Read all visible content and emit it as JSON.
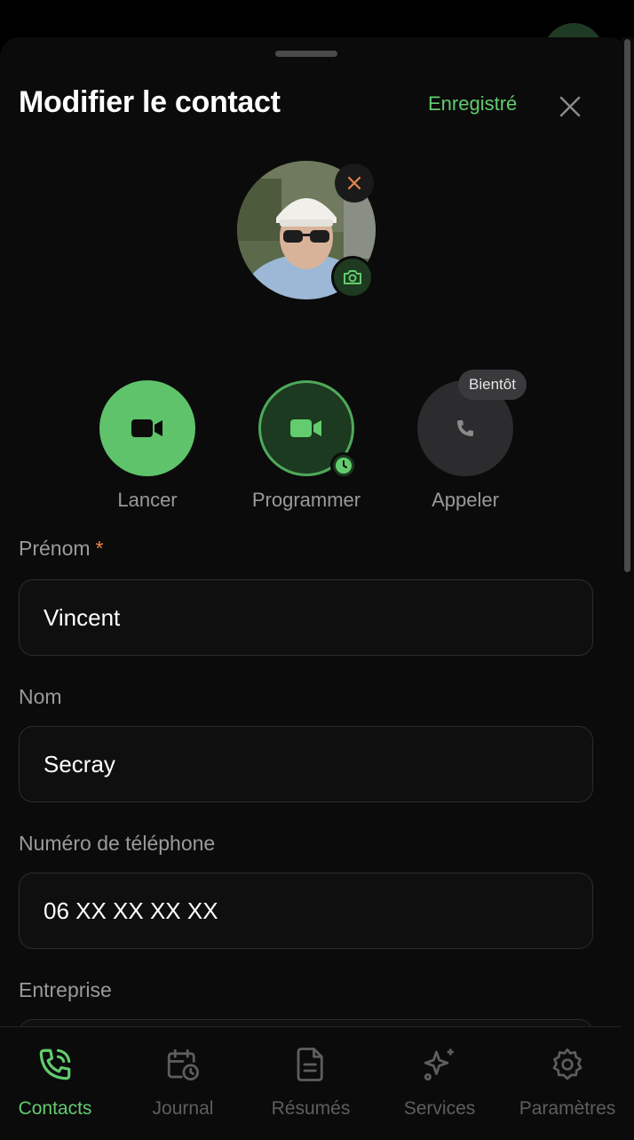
{
  "header": {
    "title": "Modifier le contact",
    "status": "Enregistré"
  },
  "actions": [
    {
      "label": "Lancer",
      "icon": "video-icon"
    },
    {
      "label": "Programmer",
      "icon": "video-icon"
    },
    {
      "label": "Appeler",
      "icon": "phone-icon",
      "badge": "Bientôt"
    }
  ],
  "form": {
    "first_name": {
      "label": "Prénom",
      "required_mark": "*",
      "value": "Vincent"
    },
    "last_name": {
      "label": "Nom",
      "value": "Secray"
    },
    "phone": {
      "label": "Numéro de téléphone",
      "value": "06 XX XX XX XX"
    },
    "company": {
      "label": "Entreprise",
      "value": ""
    }
  },
  "tabs": [
    {
      "label": "Contacts",
      "icon": "phone-call-icon",
      "active": true
    },
    {
      "label": "Journal",
      "icon": "calendar-clock-icon",
      "active": false
    },
    {
      "label": "Résumés",
      "icon": "document-icon",
      "active": false
    },
    {
      "label": "Services",
      "icon": "sparkles-icon",
      "active": false
    },
    {
      "label": "Paramètres",
      "icon": "gear-icon",
      "active": false
    }
  ],
  "colors": {
    "accent": "#62cc6e",
    "accent_bg": "#1b3a1f",
    "background": "#0b0b0b",
    "required": "#e8864a"
  }
}
